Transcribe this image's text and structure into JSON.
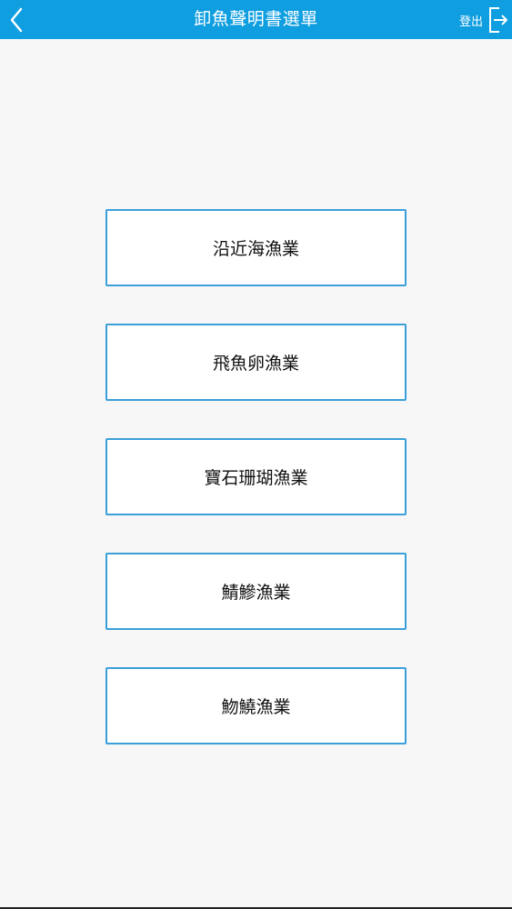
{
  "header": {
    "title": "卸魚聲明書選單",
    "logout_label": "登出",
    "background": "#0f9ee0"
  },
  "menu": {
    "items": [
      {
        "label": "沿近海漁業"
      },
      {
        "label": "飛魚卵漁業"
      },
      {
        "label": "寶石珊瑚漁業"
      },
      {
        "label": "鯖鰺漁業"
      },
      {
        "label": "魩鱙漁業"
      }
    ]
  },
  "colors": {
    "accent": "#0f9ee0",
    "button_border": "#3b9fd9",
    "page_background": "#f7f7f8"
  },
  "icons": {
    "back": "chevron-left-icon",
    "logout": "logout-icon"
  }
}
